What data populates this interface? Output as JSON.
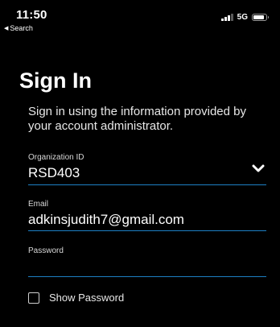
{
  "status_bar": {
    "time": "11:50",
    "back_label": "Search",
    "network": "5G",
    "icons": [
      "back-arrow-icon",
      "signal-icon",
      "battery-icon"
    ]
  },
  "signin": {
    "title": "Sign In",
    "subtitle": "Sign in using the information provided by your account administrator.",
    "org_field": {
      "label": "Organization ID",
      "value": "RSD403",
      "icon": "chevron-down-icon"
    },
    "email_field": {
      "label": "Email",
      "value": "adkinsjudith7@gmail.com"
    },
    "password_field": {
      "label": "Password",
      "value": ""
    },
    "show_password": {
      "label": "Show Password",
      "checked": false
    }
  },
  "colors": {
    "background": "#000000",
    "text": "#ffffff",
    "underline": "#1d7fc4"
  }
}
